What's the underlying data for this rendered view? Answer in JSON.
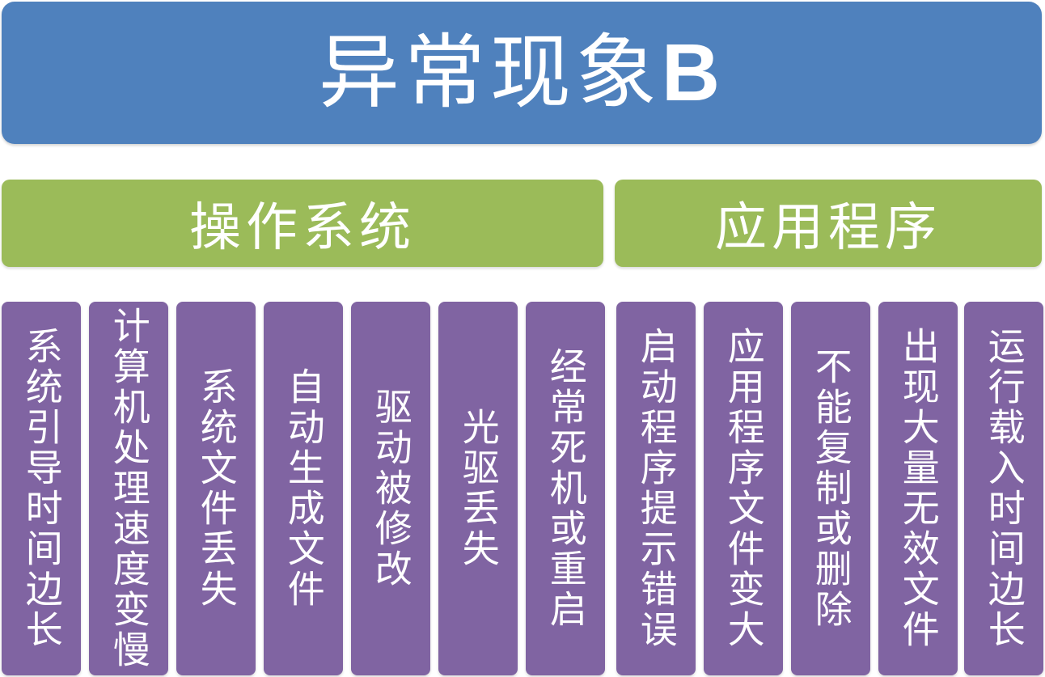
{
  "title": {
    "main": "异常现象",
    "suffix": "B"
  },
  "colors": {
    "title_bg": "#4f81bd",
    "category_bg": "#9bbb59",
    "item_bg": "#8064a2",
    "text": "#ffffff"
  },
  "categories": [
    {
      "label": "操作系统"
    },
    {
      "label": "应用程序"
    }
  ],
  "items": [
    {
      "label": "系统引导时间边长"
    },
    {
      "label": "计算机处理速度变慢"
    },
    {
      "label": "系统文件丢失"
    },
    {
      "label": "自动生成文件"
    },
    {
      "label": "驱动被修改"
    },
    {
      "label": "光驱丢失"
    },
    {
      "label": "经常死机或重启"
    },
    {
      "label": "启动程序提示错误"
    },
    {
      "label": "应用程序文件变大"
    },
    {
      "label": "不能复制或删除"
    },
    {
      "label": "出现大量无效文件"
    },
    {
      "label": "运行载入时间边长"
    }
  ]
}
